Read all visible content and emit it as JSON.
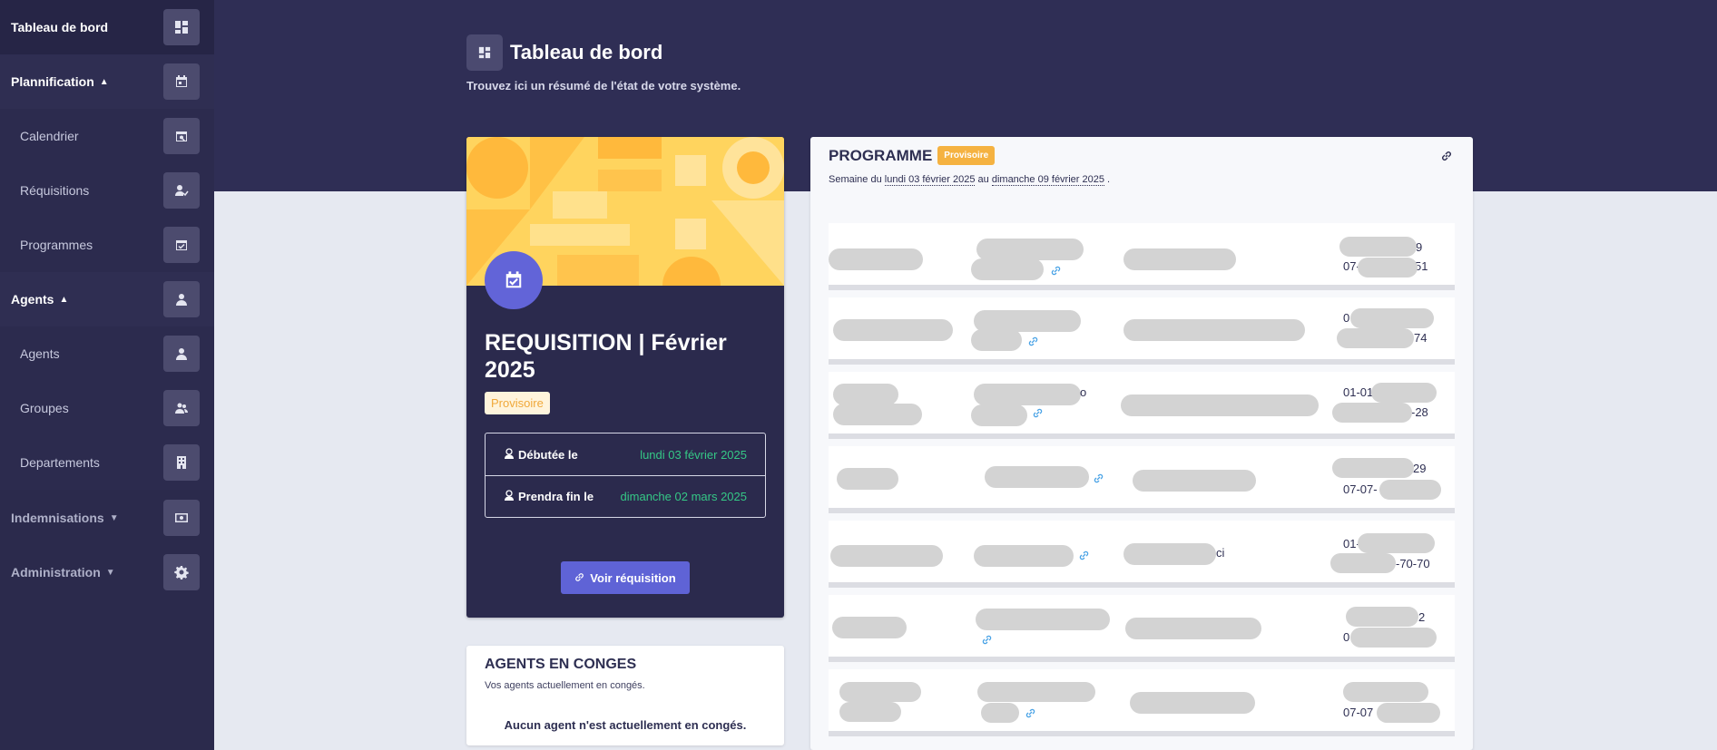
{
  "sidebar": {
    "items": [
      {
        "label": "Tableau de bord",
        "icon": "dashboard-icon"
      },
      {
        "label": "Plannification",
        "icon": "calendar-icon"
      },
      {
        "label": "Calendrier",
        "icon": "calendar-search-icon"
      },
      {
        "label": "Réquisitions",
        "icon": "user-check-icon"
      },
      {
        "label": "Programmes",
        "icon": "calendar-check-icon"
      },
      {
        "label": "Agents",
        "icon": "user-icon"
      },
      {
        "label": "Agents",
        "icon": "user-icon"
      },
      {
        "label": "Groupes",
        "icon": "users-icon"
      },
      {
        "label": "Departements",
        "icon": "building-icon"
      },
      {
        "label": "Indemnisations",
        "icon": "money-icon"
      },
      {
        "label": "Administration",
        "icon": "gear-icon"
      }
    ]
  },
  "header": {
    "title": "Tableau de bord",
    "subtitle": "Trouvez ici un résumé de l'état de votre système."
  },
  "requisition": {
    "title": "REQUISITION | Février 2025",
    "badge": "Provisoire",
    "start_label": "Débutée le",
    "start_value": "lundi 03 février 2025",
    "end_label": "Prendra fin le",
    "end_value": "dimanche 02 mars 2025",
    "button_label": "Voir réquisition"
  },
  "conges": {
    "title": "AGENTS EN CONGES",
    "subtitle": "Vos agents actuellement en congés.",
    "empty": "Aucun agent n'est actuellement en congés."
  },
  "programme": {
    "title": "PROGRAMME",
    "badge": "Provisoire",
    "week_prefix": "Semaine du",
    "week_start": "lundi 03 février 2025",
    "week_mid": "au",
    "week_end": "dimanche 09 février 2025",
    "week_suffix": ".",
    "fragments": [
      "9",
      "07-",
      "51",
      "0",
      "74",
      "o",
      "01-01",
      "-28",
      "29",
      "07-07-",
      "ci",
      "01-",
      "-70-70",
      "2",
      "0",
      "07-07"
    ]
  },
  "colors": {
    "sidebar": "#2b2a4c",
    "header": "#2f2e55",
    "accent": "#5f63d6",
    "badge": "#f5b241",
    "success": "#35c886"
  }
}
